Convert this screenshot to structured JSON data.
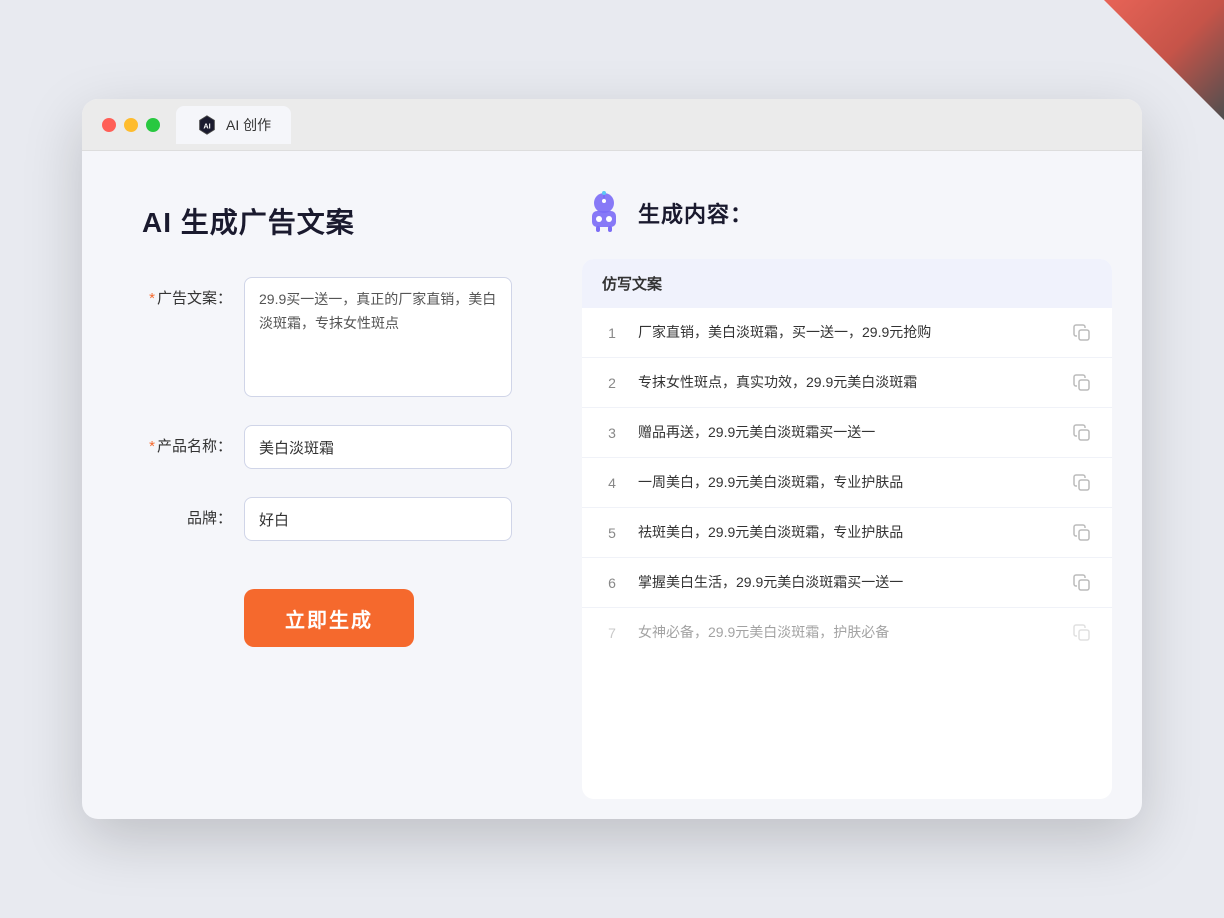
{
  "window": {
    "tab_label": "AI 创作"
  },
  "page": {
    "title": "AI 生成广告文案"
  },
  "form": {
    "ad_copy_label": "广告文案：",
    "ad_copy_required": "*",
    "ad_copy_value": "29.9买一送一，真正的厂家直销，美白淡斑霜，专抹女性斑点",
    "product_name_label": "产品名称：",
    "product_name_required": "*",
    "product_name_value": "美白淡斑霜",
    "brand_label": "品牌：",
    "brand_value": "好白",
    "generate_button": "立即生成"
  },
  "result": {
    "header_title": "生成内容：",
    "table_header": "仿写文案",
    "items": [
      {
        "num": "1",
        "text": "厂家直销，美白淡斑霜，买一送一，29.9元抢购",
        "faded": false
      },
      {
        "num": "2",
        "text": "专抹女性斑点，真实功效，29.9元美白淡斑霜",
        "faded": false
      },
      {
        "num": "3",
        "text": "赠品再送，29.9元美白淡斑霜买一送一",
        "faded": false
      },
      {
        "num": "4",
        "text": "一周美白，29.9元美白淡斑霜，专业护肤品",
        "faded": false
      },
      {
        "num": "5",
        "text": "祛斑美白，29.9元美白淡斑霜，专业护肤品",
        "faded": false
      },
      {
        "num": "6",
        "text": "掌握美白生活，29.9元美白淡斑霜买一送一",
        "faded": false
      },
      {
        "num": "7",
        "text": "女神必备，29.9元美白淡斑霜，护肤必备",
        "faded": true
      }
    ]
  },
  "colors": {
    "primary_orange": "#f5692d",
    "accent_blue": "#7b8cde",
    "bg_light": "#f5f6fa"
  }
}
